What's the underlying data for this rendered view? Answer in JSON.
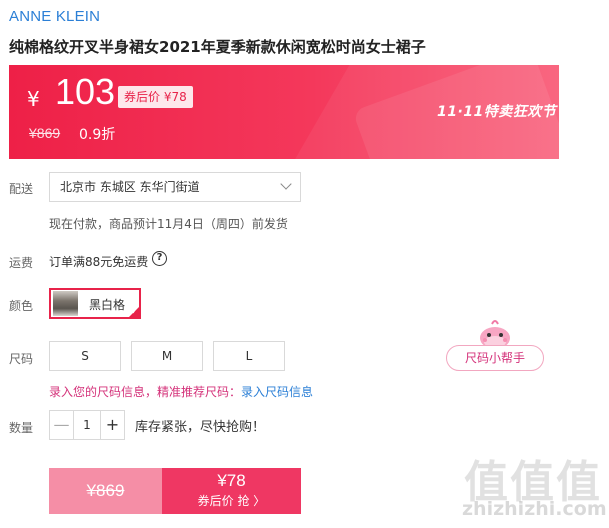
{
  "product": {
    "brand": "ANNE KLEIN",
    "title": "纯棉格纹开叉半身裙女2021年夏季新款休闲宽松时尚女士裙子"
  },
  "banner": {
    "currency": "¥",
    "price": "103",
    "coupon_tag": "券后价 ¥78",
    "original_price": "¥869",
    "discount": "0.9折",
    "promo": "11·11特卖狂欢节",
    "colors": {
      "start": "#ee2047",
      "end": "#f95d78"
    }
  },
  "delivery": {
    "label": "配送",
    "address": "北京市 东城区 东华门街道",
    "note": "现在付款，商品预计11月4日（周四）前发货"
  },
  "freight": {
    "label": "运费",
    "text": "订单满88元免运费",
    "help_icon": "?"
  },
  "color": {
    "label": "颜色",
    "selected": "黑白格",
    "check": "✓"
  },
  "size": {
    "label": "尺码",
    "options": [
      "S",
      "M",
      "L"
    ],
    "info_prefix": "录入您的尺码信息，精准推荐尺码：",
    "info_link": "录入尺码信息",
    "helper": "尺码小帮手"
  },
  "quantity": {
    "label": "数量",
    "minus": "—",
    "value": "1",
    "plus": "+",
    "stock_note": "库存紧张，尽快抢购！"
  },
  "buy": {
    "original": "¥869",
    "price": "¥78",
    "sub_label": "券后价 抢 〉"
  },
  "watermark": {
    "glyphs": "值值值",
    "text": "zhizhizhi.com"
  }
}
